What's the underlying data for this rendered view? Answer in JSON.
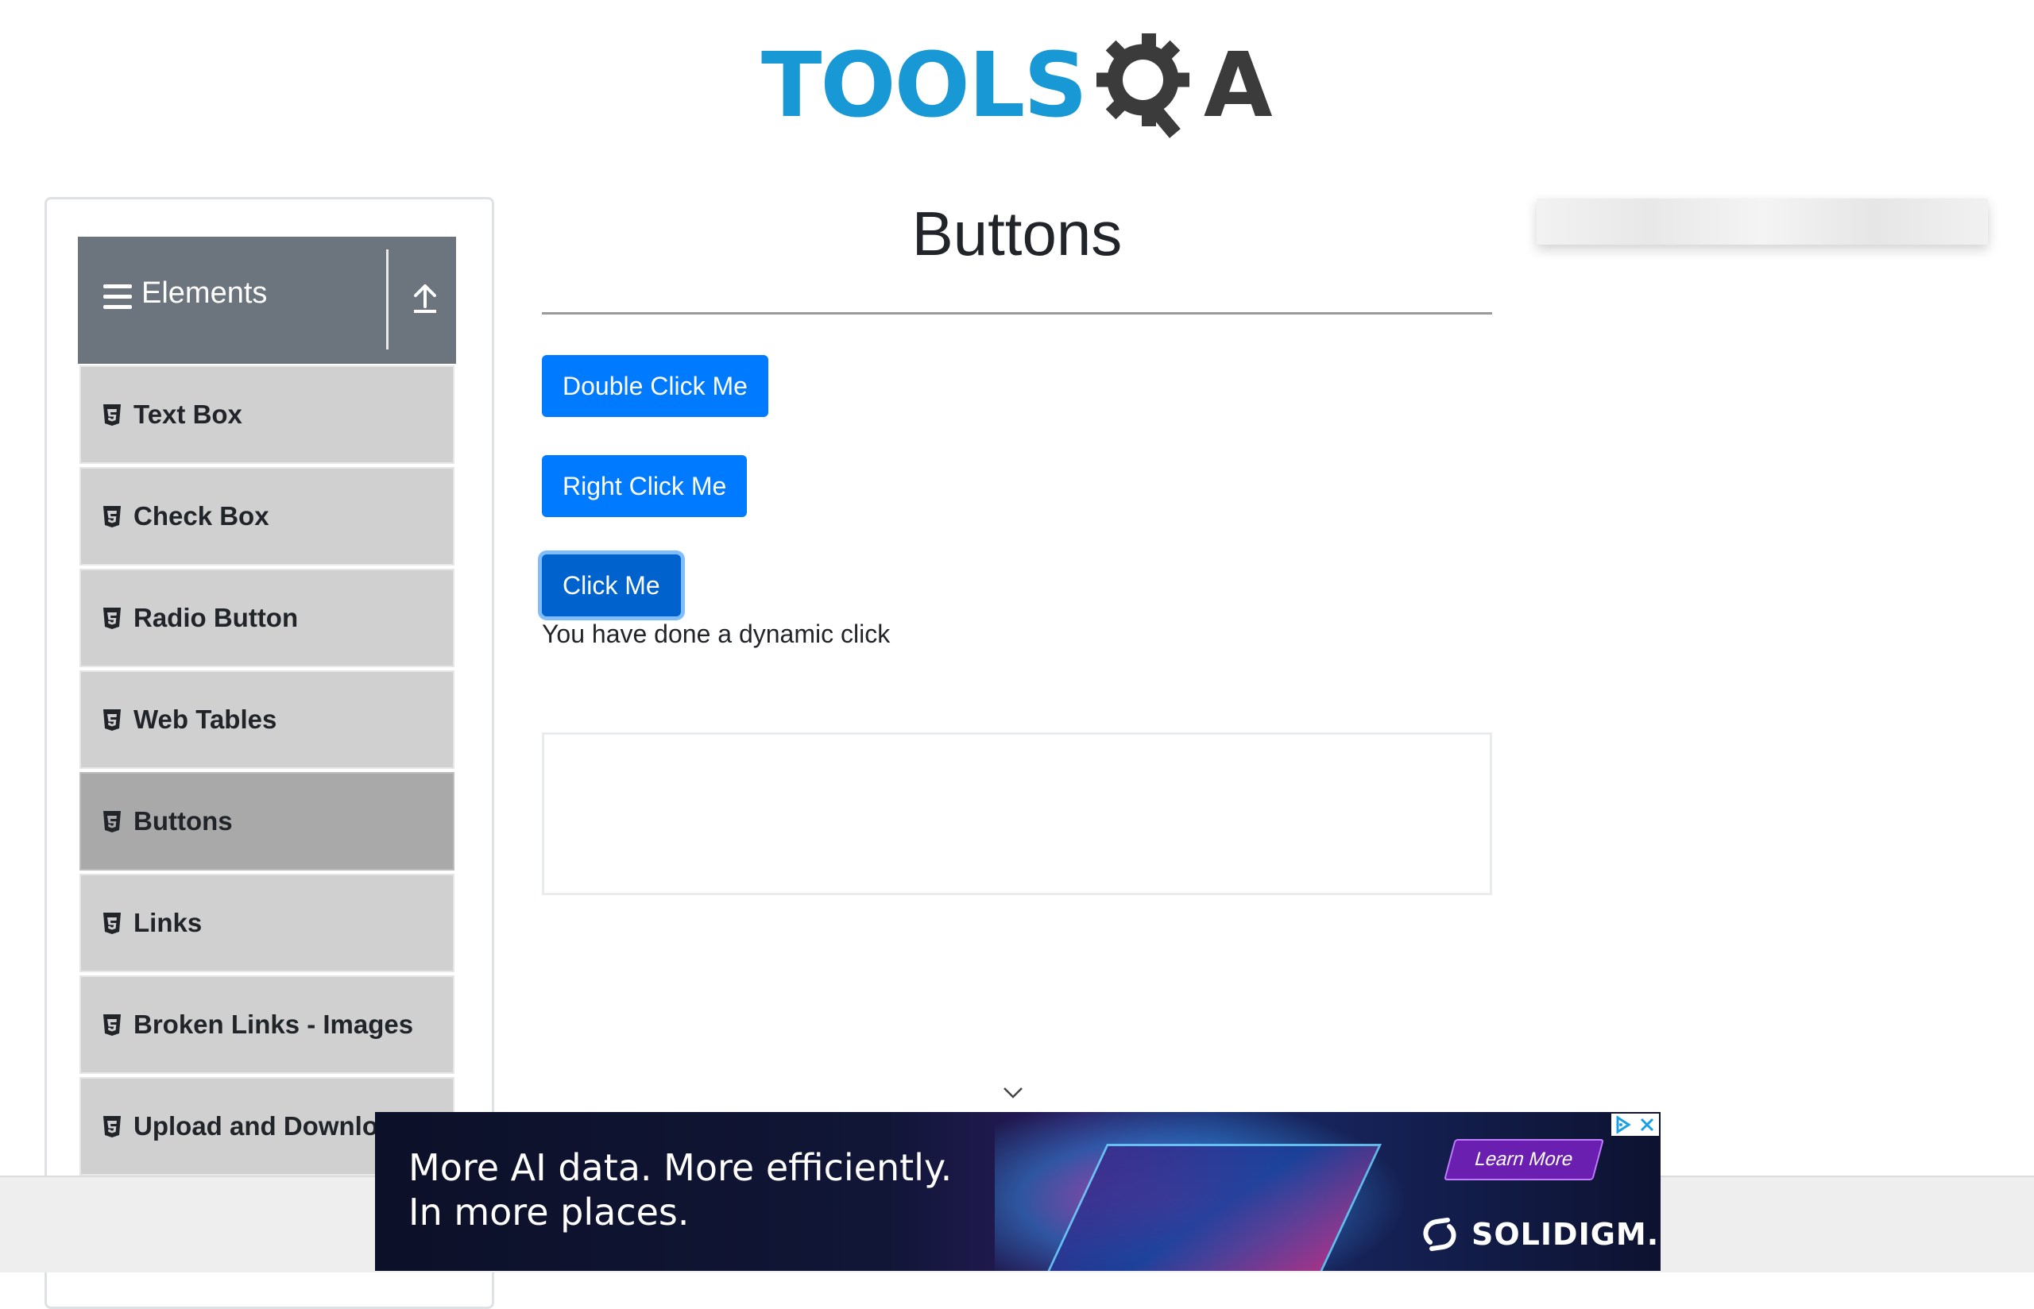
{
  "header": {
    "logo_text": "TOOLS",
    "logo_letter": "A"
  },
  "sidebar": {
    "group_title": "Elements",
    "items": [
      {
        "label": "Text Box"
      },
      {
        "label": "Check Box"
      },
      {
        "label": "Radio Button"
      },
      {
        "label": "Web Tables"
      },
      {
        "label": "Buttons",
        "active": true
      },
      {
        "label": "Links"
      },
      {
        "label": "Broken Links - Images"
      },
      {
        "label": "Upload and Download"
      }
    ]
  },
  "main": {
    "title": "Buttons",
    "buttons": {
      "double_click": "Double Click Me",
      "right_click": "Right Click Me",
      "click": "Click Me"
    },
    "message": "You have done a dynamic click"
  },
  "ad": {
    "headline_line1": "More AI data. More efficiently.",
    "headline_line2": "In more places.",
    "cta": "Learn More",
    "brand": "SOLIDIGM."
  },
  "colors": {
    "primary": "#007bff",
    "primary_active": "#0062cc",
    "sidebar_header": "#6c757d",
    "menu_item": "#d0d0d0",
    "menu_item_active": "#a9a9a9",
    "logo_blue": "#1898d5"
  }
}
